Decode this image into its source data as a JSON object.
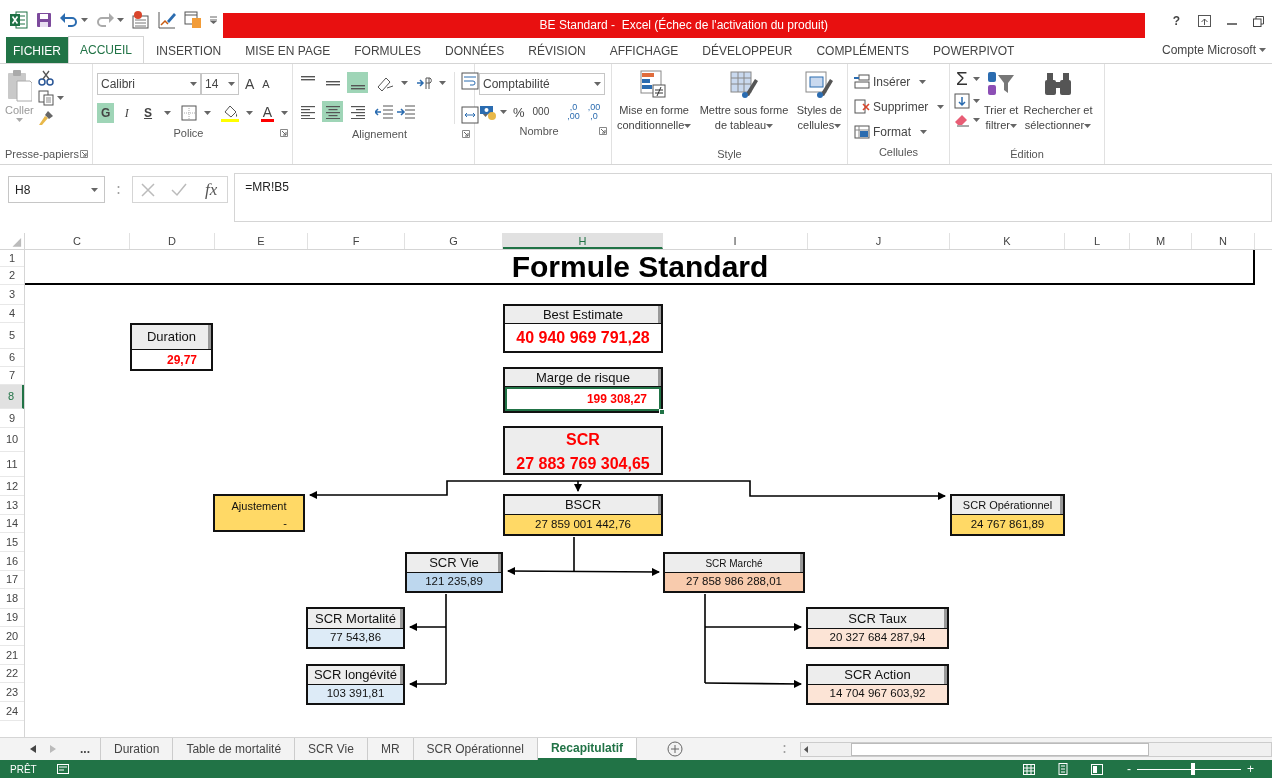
{
  "window": {
    "title": "BE Standard -  Excel (Échec de l'activation du produit)",
    "help": "?"
  },
  "ribbon_tabs": [
    {
      "label": "FICHIER",
      "kind": "file",
      "selected": false
    },
    {
      "label": "ACCUEIL",
      "kind": "tab",
      "selected": true
    },
    {
      "label": "INSERTION",
      "kind": "tab",
      "selected": false
    },
    {
      "label": "MISE EN PAGE",
      "kind": "tab",
      "selected": false
    },
    {
      "label": "FORMULES",
      "kind": "tab",
      "selected": false
    },
    {
      "label": "DONNÉES",
      "kind": "tab",
      "selected": false
    },
    {
      "label": "RÉVISION",
      "kind": "tab",
      "selected": false
    },
    {
      "label": "AFFICHAGE",
      "kind": "tab",
      "selected": false
    },
    {
      "label": "DÉVELOPPEUR",
      "kind": "tab",
      "selected": false
    },
    {
      "label": "COMPLÉMENTS",
      "kind": "tab",
      "selected": false
    },
    {
      "label": "POWERPIVOT",
      "kind": "tab",
      "selected": false
    }
  ],
  "account": "Compte Microsoft",
  "ribbon": {
    "clipboard": {
      "label": "Presse-papiers",
      "paste": "Coller"
    },
    "font": {
      "label": "Police",
      "family": "Calibri",
      "size": "14",
      "grow": "A",
      "shrink": "A",
      "font_color": "A",
      "styles": [
        {
          "text": "G",
          "selected": true
        },
        {
          "text": "I",
          "selected": false
        },
        {
          "text": "S",
          "selected": false
        }
      ]
    },
    "alignment": {
      "label": "Alignement",
      "vertical": [
        {
          "selected": false
        },
        {
          "selected": false
        },
        {
          "selected": true
        }
      ],
      "horizontal": [
        {
          "selected": false
        },
        {
          "selected": true
        },
        {
          "selected": false
        }
      ]
    },
    "number": {
      "label": "Nombre",
      "format": "Comptabilité",
      "percent": "%",
      "thousands": "000",
      "decimals": [
        [
          ",0",
          ",00"
        ],
        [
          ",00",
          ",0"
        ]
      ]
    },
    "styles": {
      "label": "Style",
      "buttons": [
        [
          "Mise en forme",
          "conditionnelle"
        ],
        [
          "Mettre sous forme",
          "de tableau"
        ],
        [
          "Styles de",
          "cellules"
        ]
      ]
    },
    "cells": {
      "label": "Cellules",
      "buttons": [
        "Insérer",
        "Supprimer",
        "Format"
      ]
    },
    "editing": {
      "label": "Édition",
      "sum": "Σ",
      "buttons": [
        [
          "Trier et",
          "filtrer"
        ],
        [
          "Rechercher et",
          "sélectionner"
        ]
      ]
    }
  },
  "formula_bar": {
    "name_box": "H8",
    "function": "fx",
    "formula": "=MR!B5"
  },
  "columns": [
    {
      "label": "C",
      "selected": false
    },
    {
      "label": "D",
      "selected": false
    },
    {
      "label": "E",
      "selected": false
    },
    {
      "label": "F",
      "selected": false
    },
    {
      "label": "G",
      "selected": false
    },
    {
      "label": "H",
      "selected": true
    },
    {
      "label": "I",
      "selected": false
    },
    {
      "label": "J",
      "selected": false
    },
    {
      "label": "K",
      "selected": false
    },
    {
      "label": "L",
      "selected": false
    },
    {
      "label": "M",
      "selected": false
    },
    {
      "label": "N",
      "selected": false
    }
  ],
  "rows": [
    {
      "label": "1",
      "selected": false
    },
    {
      "label": "2",
      "selected": false
    },
    {
      "label": "3",
      "selected": false
    },
    {
      "label": "4",
      "selected": false
    },
    {
      "label": "5",
      "selected": false
    },
    {
      "label": "6",
      "selected": false
    },
    {
      "label": "7",
      "selected": false
    },
    {
      "label": "8",
      "selected": true
    },
    {
      "label": "9",
      "selected": false
    },
    {
      "label": "10",
      "selected": false
    },
    {
      "label": "11",
      "selected": false
    },
    {
      "label": "12",
      "selected": false
    },
    {
      "label": "13",
      "selected": false
    },
    {
      "label": "14",
      "selected": false
    },
    {
      "label": "15",
      "selected": false
    },
    {
      "label": "16",
      "selected": false
    },
    {
      "label": "17",
      "selected": false
    },
    {
      "label": "18",
      "selected": false
    },
    {
      "label": "19",
      "selected": false
    },
    {
      "label": "20",
      "selected": false
    },
    {
      "label": "21",
      "selected": false
    },
    {
      "label": "22",
      "selected": false
    },
    {
      "label": "23",
      "selected": false
    },
    {
      "label": "24",
      "selected": false
    }
  ],
  "sheet": {
    "title": "Formule Standard",
    "boxes": [
      {
        "kind": "minor",
        "header": "Duration",
        "value": "29,77",
        "color": "#ffffff",
        "selected": false
      },
      {
        "kind": "key",
        "header": "Best Estimate",
        "value": "40 940 969 791,28",
        "color": "#ffffff",
        "selected": false
      },
      {
        "kind": "minor",
        "header": "Marge de risque",
        "value": "199 308,27",
        "color": "#ffffff",
        "selected": true
      },
      {
        "kind": "summary",
        "header": "SCR",
        "value": "27 883 769 304,65",
        "color": "#ededed",
        "selected": false
      },
      {
        "kind": "single",
        "header": "Ajustement",
        "value": "-",
        "color": "#ffd966",
        "selected": false
      },
      {
        "kind": "node",
        "header": "BSCR",
        "value": "27 859 001 442,76",
        "color": "#ffd966",
        "selected": false
      },
      {
        "kind": "node",
        "header": "SCR Opérationnel",
        "value": "24 767 861,89",
        "color": "#ffd966",
        "selected": false
      },
      {
        "kind": "node",
        "header": "SCR Vie",
        "value": "121 235,89",
        "color": "#bdd7ee",
        "selected": false
      },
      {
        "kind": "node",
        "header": "SCR Marché",
        "value": "27 858 986 288,01",
        "color": "#f8cbad",
        "selected": false
      },
      {
        "kind": "node",
        "header": "SCR Mortalité",
        "value": "77 543,86",
        "color": "#ddebf7",
        "selected": false
      },
      {
        "kind": "node",
        "header": "SCR longévité",
        "value": "103 391,81",
        "color": "#ddebf7",
        "selected": false
      },
      {
        "kind": "node",
        "header": "SCR Taux",
        "value": "20 327 684 287,94",
        "color": "#fce4d6",
        "selected": false
      },
      {
        "kind": "node",
        "header": "SCR Action",
        "value": "14 704 967 603,92",
        "color": "#fce4d6",
        "selected": false
      }
    ]
  },
  "sheet_tabs": {
    "more": "...",
    "tabs": [
      {
        "label": "Duration",
        "selected": false
      },
      {
        "label": "Table de mortalité",
        "selected": false
      },
      {
        "label": "SCR Vie",
        "selected": false
      },
      {
        "label": "MR",
        "selected": false
      },
      {
        "label": "SCR Opérationnel",
        "selected": false
      },
      {
        "label": "Recapitulatif",
        "selected": true
      }
    ]
  },
  "status_bar": {
    "status": "PRÊT",
    "zoom": {
      "minus": "-",
      "plus": "+",
      "level": 0.54
    }
  }
}
